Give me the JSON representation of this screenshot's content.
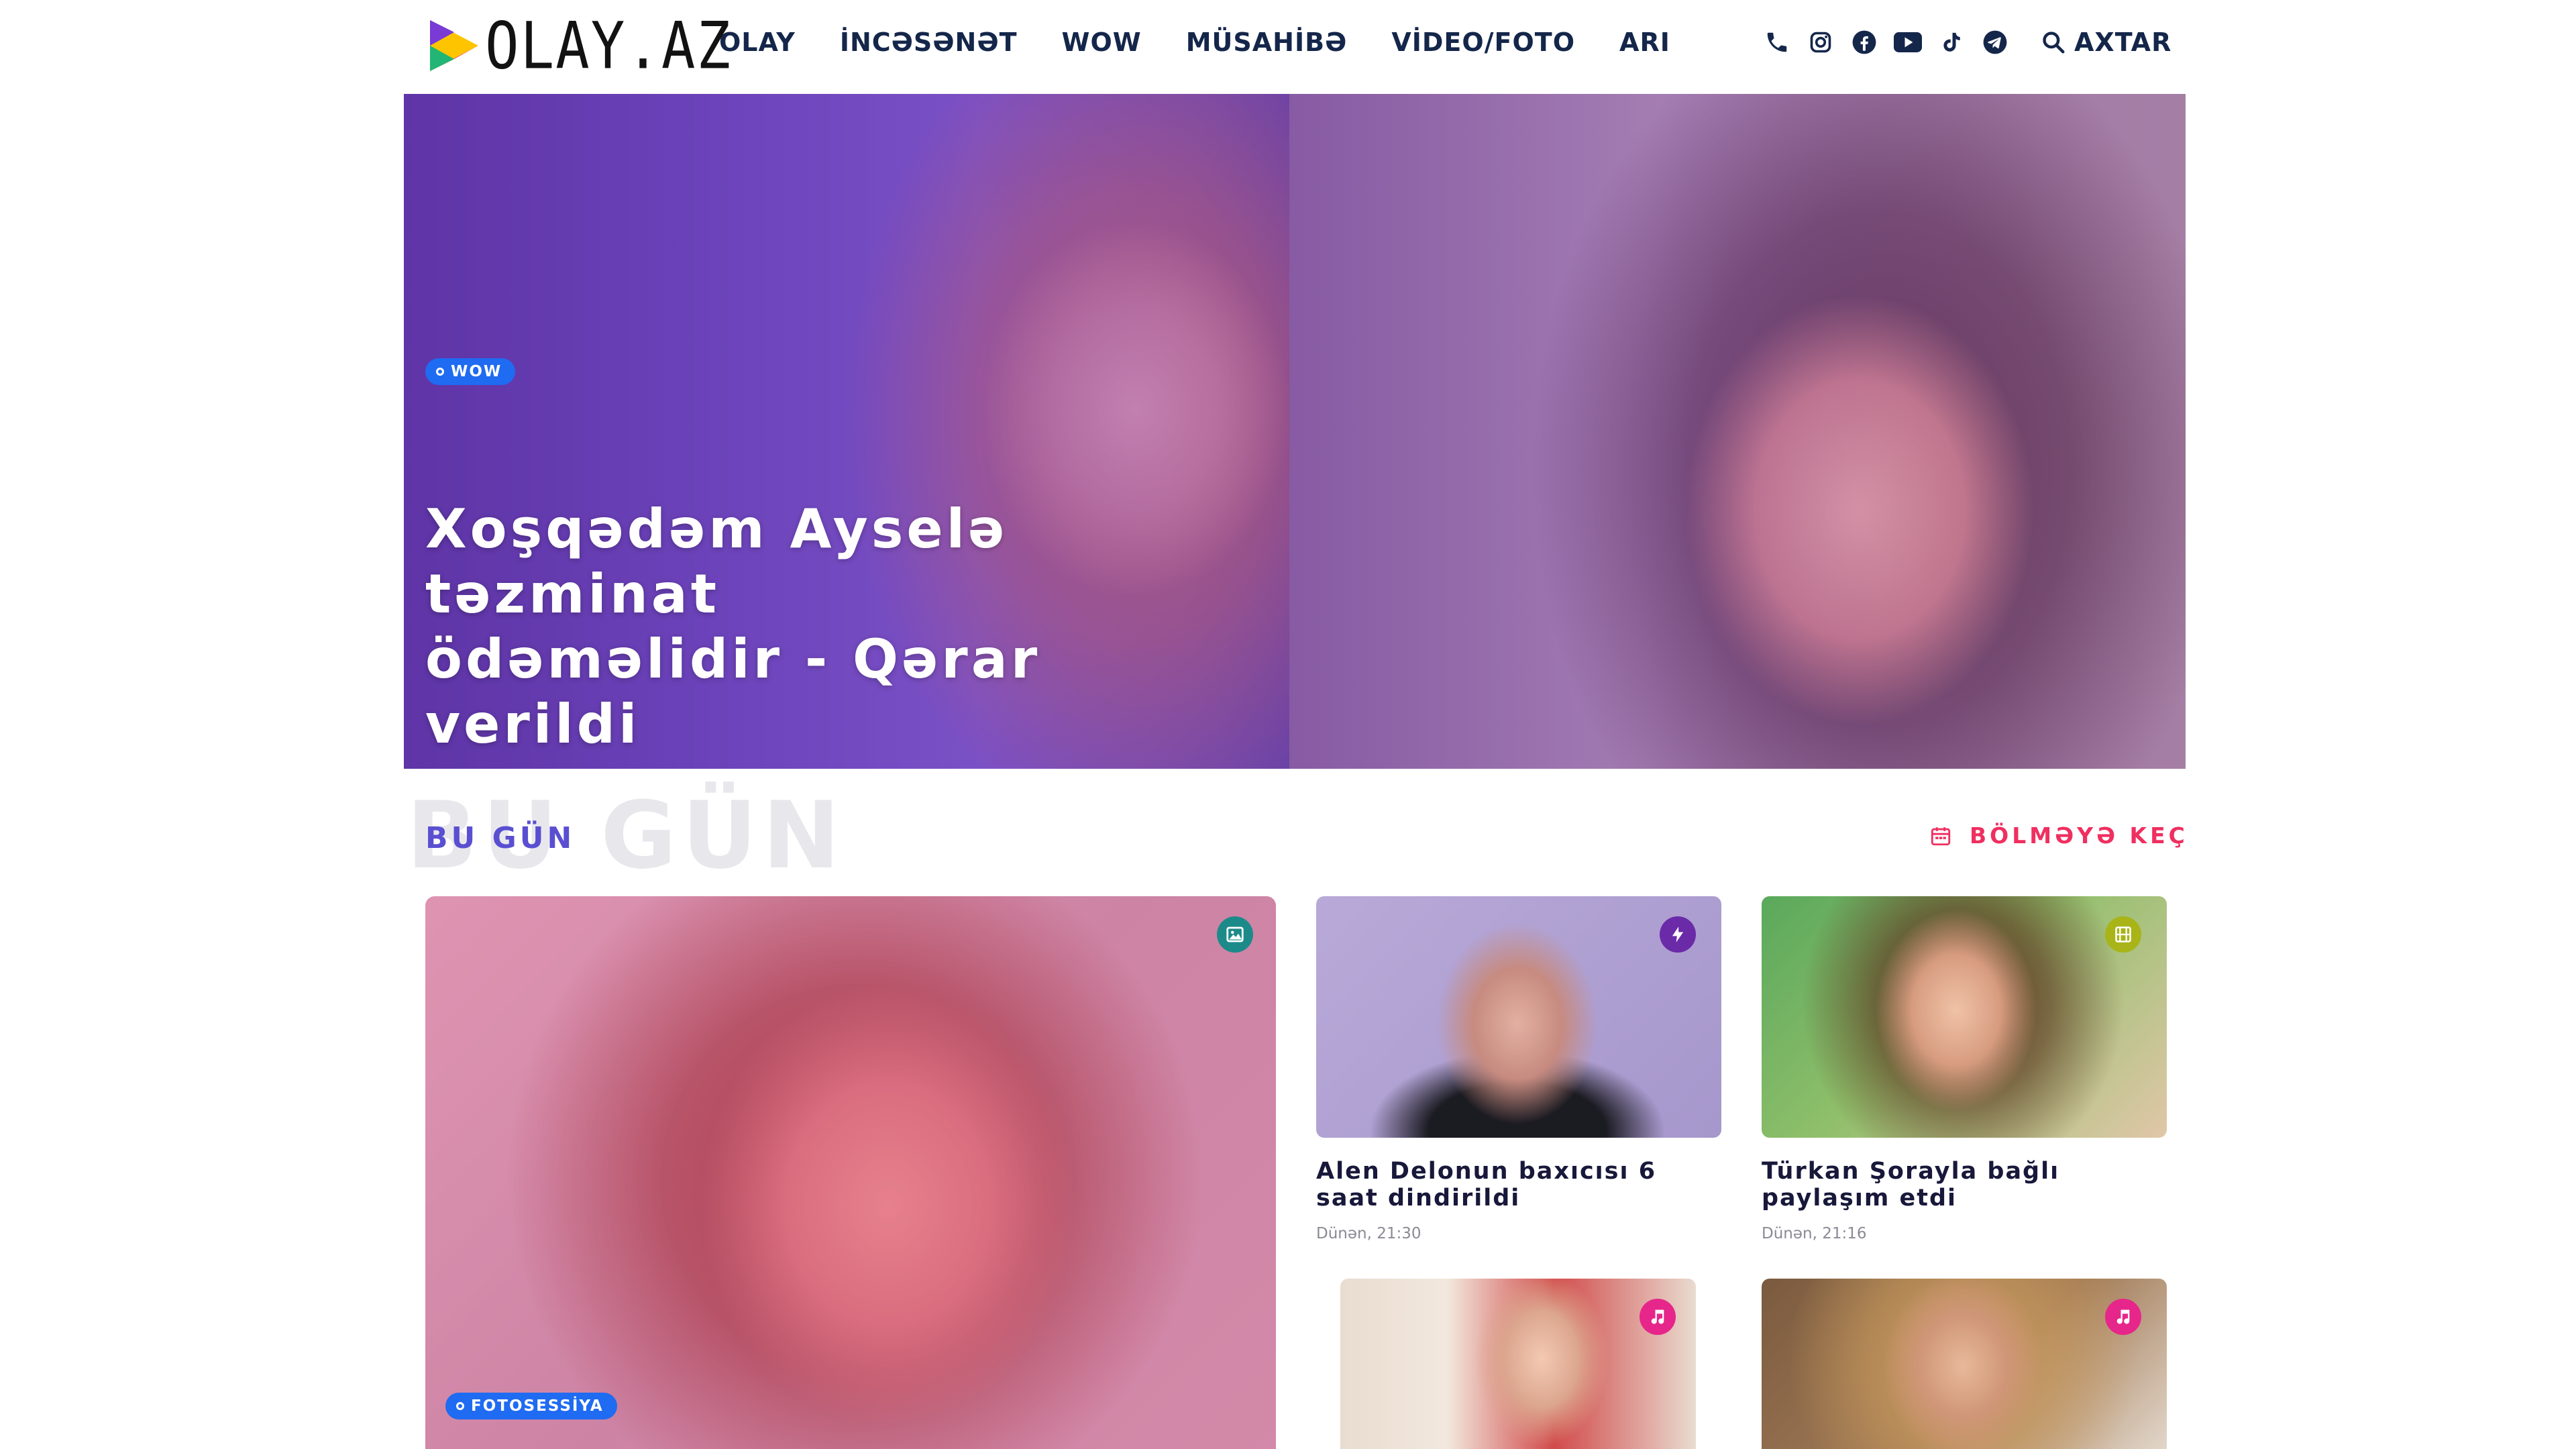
{
  "header": {
    "logo_text": "OLAY.AZ",
    "nav": [
      "OLAY",
      "İNCƏSƏNƏT",
      "WOW",
      "MÜSAHİBƏ",
      "VİDEO/FOTO",
      "ARI"
    ],
    "social_icons": [
      "phone-icon",
      "instagram-icon",
      "facebook-icon",
      "youtube-icon",
      "tiktok-icon",
      "telegram-icon"
    ],
    "search_label": "AXTAR"
  },
  "hero": {
    "tag": "WOW",
    "title": "Xoşqədəm Aysel­ə təzminat ödəməlidir - Qərar verildi"
  },
  "section": {
    "ghost": "BU GÜN",
    "title": "BU GÜN",
    "link_label": "BÖLMƏYƏ KEÇ"
  },
  "featured": {
    "tag": "FOTOSESSİYA",
    "badge_icon": "image-icon"
  },
  "cards": [
    {
      "title": "Alen Delonun baxıcısı 6 saat dindirildi",
      "time": "Dünən, 21:30",
      "badge_icon": "lightning-icon"
    },
    {
      "title": "Türkan Şorayla bağlı paylaşım etdi",
      "time": "Dünən, 21:16",
      "badge_icon": "film-icon"
    },
    {
      "title": "",
      "time": "",
      "badge_icon": "music-icon"
    },
    {
      "title": "",
      "time": "",
      "badge_icon": "music-icon"
    }
  ],
  "colors": {
    "nav_text": "#14264a",
    "tag_blue": "#1f6bf2",
    "section_title": "#5a4fd1",
    "section_link": "#ef2f60",
    "badge_teal": "#1d8a8a",
    "badge_purple": "#6b2aa8",
    "badge_olive": "#a8b418",
    "badge_pink": "#e6268a"
  }
}
